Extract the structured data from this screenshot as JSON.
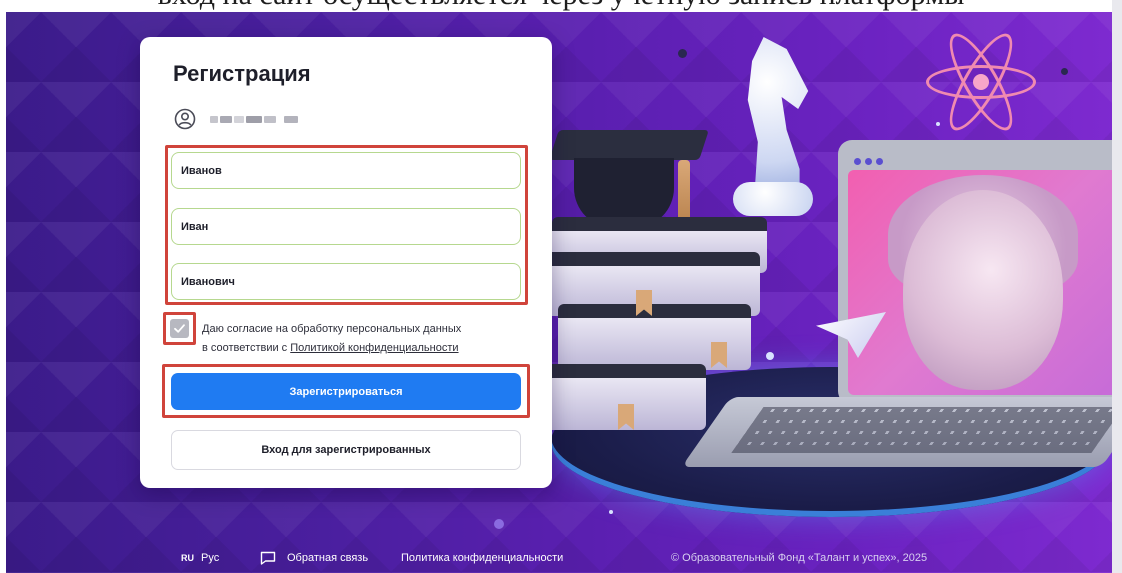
{
  "page_header": {
    "cut_text": "вход на сайт осуществляется через учетную запись платформы"
  },
  "form": {
    "title": "Регистрация",
    "surname": {
      "value": "Иванов"
    },
    "name": {
      "value": "Иван"
    },
    "patronymic": {
      "value": "Иванович"
    },
    "consent": {
      "checked": true,
      "text_line1": "Даю согласие на обработку персональных данных",
      "text_line2_prefix": "в соответствии с ",
      "link_text": "Политикой конфиденциальности"
    },
    "register_button": "Зарегистрироваться",
    "login_button": "Вход для зарегистрированных"
  },
  "footer": {
    "lang_code": "RU",
    "lang_label": "Рус",
    "feedback": "Обратная связь",
    "privacy": "Политика конфиденциальности",
    "copyright": "© Образовательный Фонд «Талант и успех», 2025"
  },
  "colors": {
    "primary_button": "#1f7bf2",
    "highlight_frame": "#d0443b",
    "field_border": "#b6d88f",
    "background": "#4b1fa0"
  },
  "icons": {
    "user": "user-circle-icon",
    "check": "check-icon",
    "feedback": "chat-bubble-icon"
  }
}
